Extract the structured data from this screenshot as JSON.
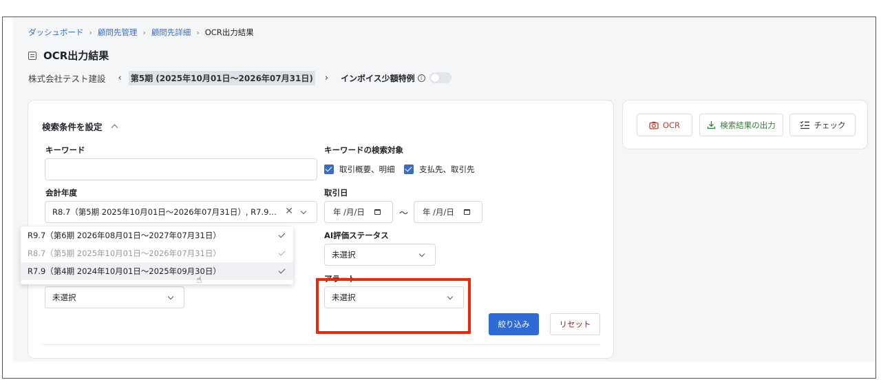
{
  "breadcrumb": [
    {
      "label": "ダッシュボード",
      "link": true
    },
    {
      "label": "顧問先管理",
      "link": true
    },
    {
      "label": "顧問先詳細",
      "link": true
    },
    {
      "label": "OCR出力結果",
      "link": false
    }
  ],
  "breadcrumb_sep": "›",
  "page_title": "OCR出力結果",
  "company": "株式会社テスト建設",
  "period": {
    "prev": "‹",
    "label": "第5期 (2025年10月01日〜2026年07月31日)",
    "next": "›"
  },
  "invoice": {
    "label": "インボイス少額特例",
    "info": "i",
    "enabled": false
  },
  "actions": {
    "ocr": "OCR",
    "export": "検索結果の出力",
    "check": "チェック"
  },
  "search": {
    "title": "検索条件を設定",
    "keyword_label": "キーワード",
    "keyword_value": "",
    "keyword_target_label": "キーワードの検索対象",
    "target_summary": "取引概要、明細",
    "target_partner": "支払先、取引先",
    "fiscal_year_label": "会計年度",
    "fiscal_year_value": "R8.7（第5期 2025年10月01日〜2026年07月31日）, R7.9…",
    "fiscal_year_clear": "✕",
    "fiscal_options": [
      {
        "label": "R9.7（第6期 2026年08月01日〜2027年07月31日）",
        "selected": false
      },
      {
        "label": "R8.7（第5期 2025年10月01日〜2026年07月31日）",
        "selected": true
      },
      {
        "label": "R7.9（第4期 2024年10月01日〜2025年09月30日）",
        "selected": true
      }
    ],
    "transaction_date_label": "取引日",
    "date_placeholder": "年 /月/日",
    "date_range_sep": "〜",
    "ai_status_label": "AI評価ステータス",
    "ai_status_value": "未選択",
    "hidden_select_value": "未選択",
    "alert_label": "アラート",
    "alert_value": "未選択",
    "filter_button": "絞り込み",
    "reset_button": "リセット"
  },
  "colors": {
    "primary": "#2f6bd8",
    "link": "#3b6cc4",
    "highlight": "#f0280a",
    "reset_text": "#8b1a1a"
  }
}
